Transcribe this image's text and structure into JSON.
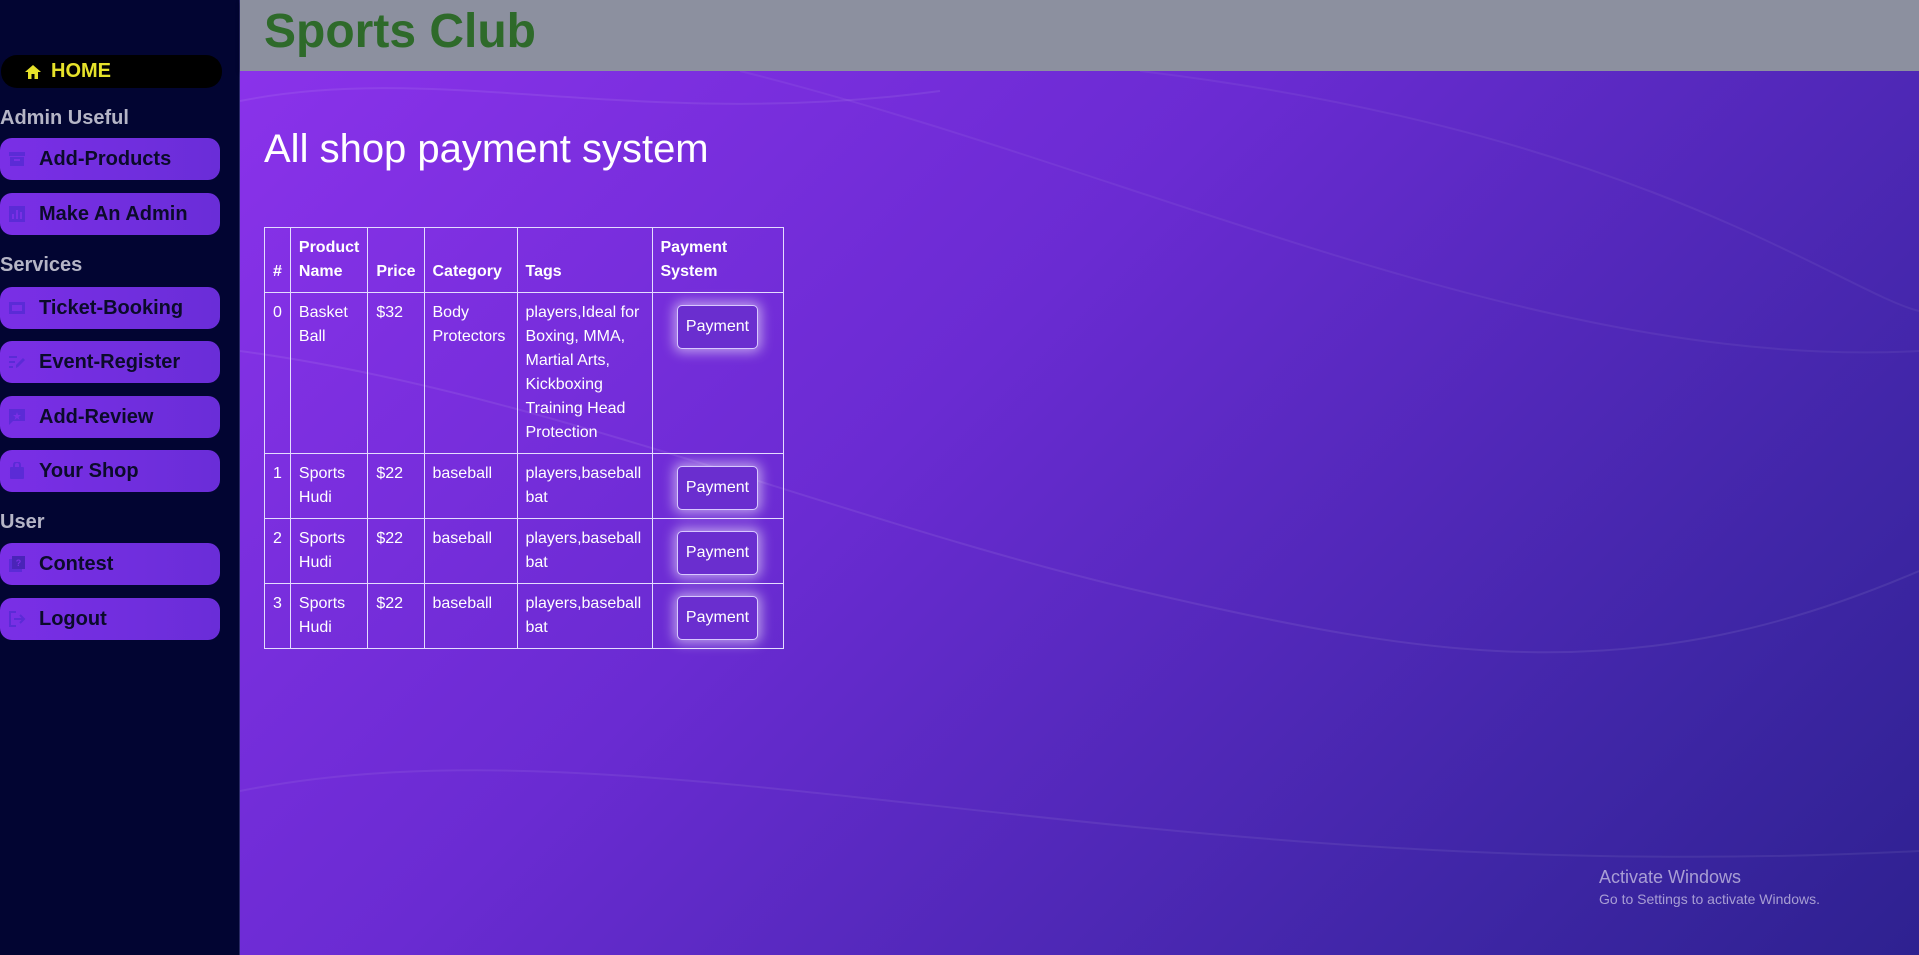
{
  "header": {
    "brand": "Sports Club"
  },
  "sidebar": {
    "home_label": "HOME",
    "sections": [
      {
        "title": "Admin Useful",
        "items": [
          {
            "label": "Add-Products",
            "icon": "archive-icon"
          },
          {
            "label": "Make An Admin",
            "icon": "chart-icon"
          }
        ]
      },
      {
        "title": "Services",
        "items": [
          {
            "label": "Ticket-Booking",
            "icon": "ticket-icon"
          },
          {
            "label": "Event-Register",
            "icon": "edit-icon"
          },
          {
            "label": "Add-Review",
            "icon": "review-icon"
          },
          {
            "label": "Your Shop",
            "icon": "bag-icon"
          }
        ]
      },
      {
        "title": "User",
        "items": [
          {
            "label": "Contest",
            "icon": "quiz-icon"
          },
          {
            "label": "Logout",
            "icon": "logout-icon"
          }
        ]
      }
    ]
  },
  "main": {
    "page_title": "All shop payment system",
    "table": {
      "headers": [
        "#",
        "Product Name",
        "Price",
        "Category",
        "Tags",
        "Payment System"
      ],
      "rows": [
        {
          "index": "0",
          "name": "Basket Ball",
          "price": "$32",
          "category": "Body Protectors",
          "tags": "players,Ideal for Boxing, MMA, Martial Arts, Kickboxing Training Head Protection",
          "button": "Payment"
        },
        {
          "index": "1",
          "name": "Sports Hudi",
          "price": "$22",
          "category": "baseball",
          "tags": "players,baseball bat",
          "button": "Payment"
        },
        {
          "index": "2",
          "name": "Sports Hudi",
          "price": "$22",
          "category": "baseball",
          "tags": "players,baseball bat",
          "button": "Payment"
        },
        {
          "index": "3",
          "name": "Sports Hudi",
          "price": "$22",
          "category": "baseball",
          "tags": "players,baseball bat",
          "button": "Payment"
        }
      ]
    }
  },
  "watermark": {
    "title": "Activate Windows",
    "subtitle": "Go to Settings to activate Windows."
  },
  "colors": {
    "sidebar_bg": "#020532",
    "nav_button": "#7a2fe6",
    "home_text": "#e6e22a",
    "brand": "#2e6a2a",
    "header_bg": "#8c909f"
  }
}
